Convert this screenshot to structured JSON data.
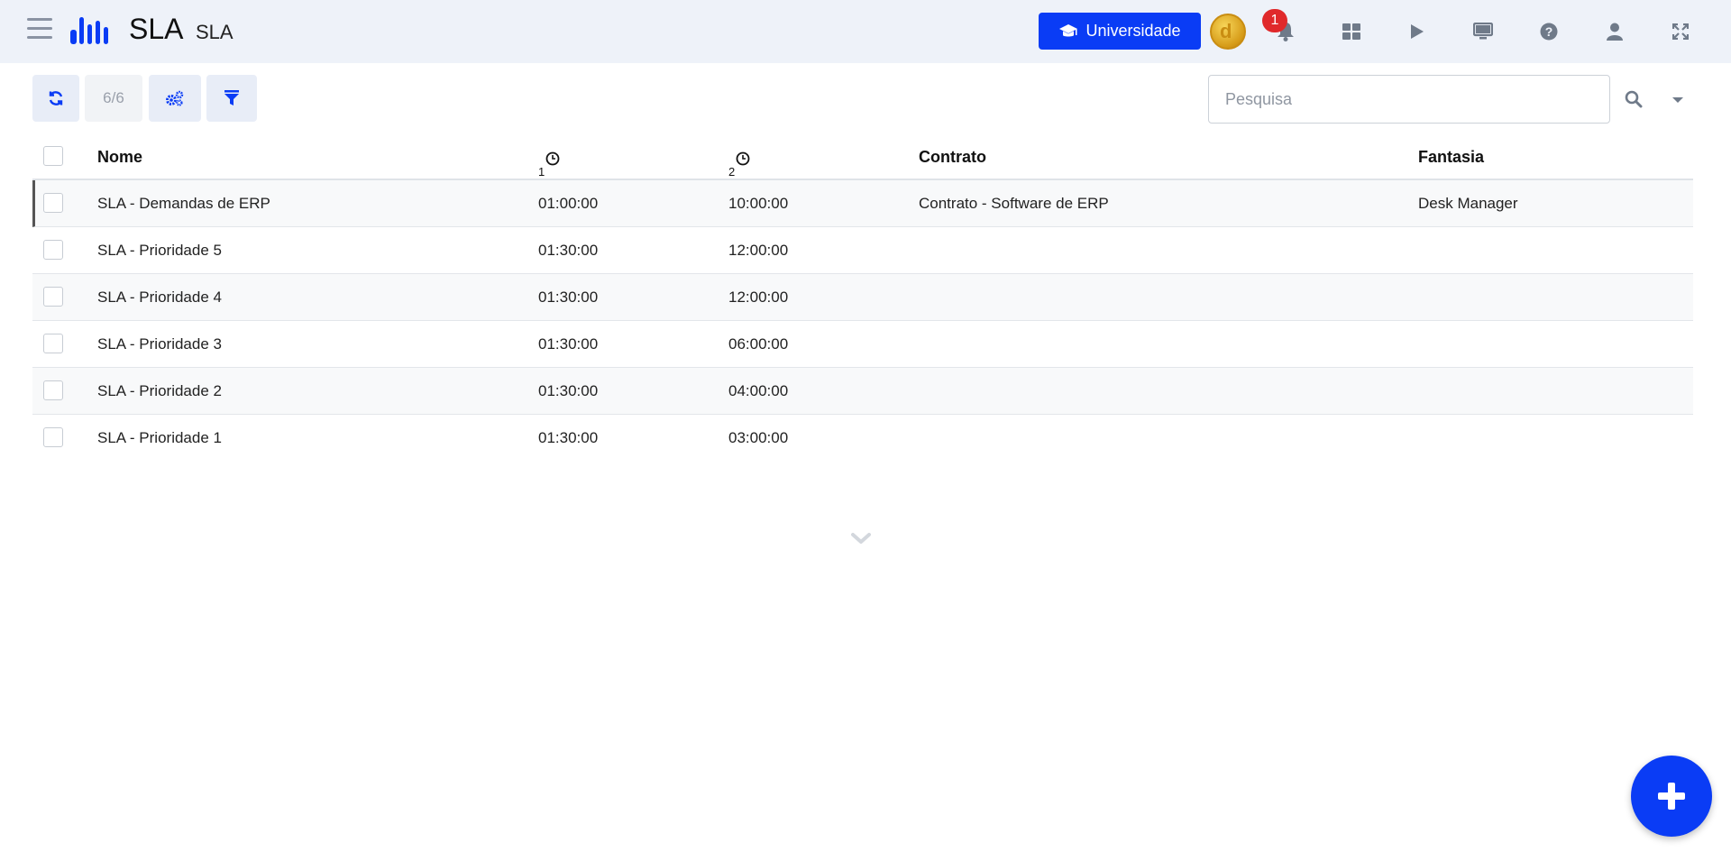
{
  "header": {
    "title": "SLA",
    "subtitle": "SLA",
    "university_label": "Universidade",
    "notification_count": "1"
  },
  "toolbar": {
    "counter": "6/6",
    "search_placeholder": "Pesquisa"
  },
  "table": {
    "columns": [
      "Nome",
      "1",
      "2",
      "Contrato",
      "Fantasia"
    ],
    "rows": [
      {
        "nome": "SLA - Demandas de ERP",
        "t1": "01:00:00",
        "t2": "10:00:00",
        "contrato": "Contrato - Software de ERP",
        "fantasia": "Desk Manager"
      },
      {
        "nome": "SLA - Prioridade 5",
        "t1": "01:30:00",
        "t2": "12:00:00",
        "contrato": "",
        "fantasia": ""
      },
      {
        "nome": "SLA - Prioridade 4",
        "t1": "01:30:00",
        "t2": "12:00:00",
        "contrato": "",
        "fantasia": ""
      },
      {
        "nome": "SLA - Prioridade 3",
        "t1": "01:30:00",
        "t2": "06:00:00",
        "contrato": "",
        "fantasia": ""
      },
      {
        "nome": "SLA - Prioridade 2",
        "t1": "01:30:00",
        "t2": "04:00:00",
        "contrato": "",
        "fantasia": ""
      },
      {
        "nome": "SLA - Prioridade 1",
        "t1": "01:30:00",
        "t2": "03:00:00",
        "contrato": "",
        "fantasia": ""
      }
    ]
  },
  "colors": {
    "accent": "#0a3cf5",
    "topbar_bg": "#eef2f9",
    "badge": "#e0292b"
  },
  "icons": {
    "menu": "hamburger-icon",
    "logo": "bars-logo",
    "notifications": "bell-icon",
    "apps": "grid-icon",
    "play": "play-icon",
    "monitor": "monitor-icon",
    "help": "question-icon",
    "user": "user-icon",
    "fullscreen": "expand-icon"
  }
}
